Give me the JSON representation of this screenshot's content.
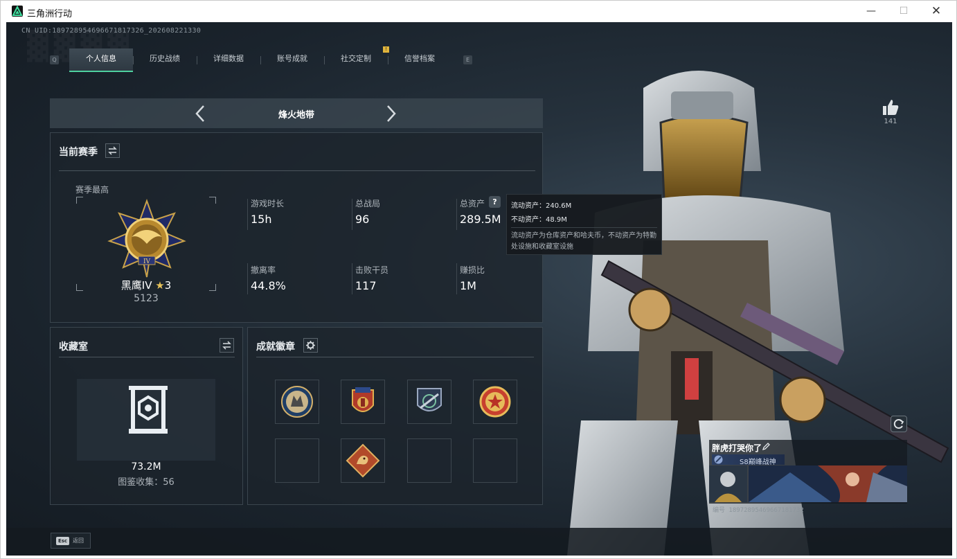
{
  "window": {
    "title": "三角洲行动",
    "minimize_label": "—",
    "maximize_label": "☐",
    "close_label": "✕"
  },
  "header": {
    "uid": "CN UID:18972895469667181732​6_202608221330",
    "tab_key_left": "Q",
    "tab_key_right": "E",
    "tabs": [
      {
        "label": "个人信息",
        "active": true
      },
      {
        "label": "历史战绩",
        "active": false
      },
      {
        "label": "详细数据",
        "active": false
      },
      {
        "label": "账号成就",
        "active": false
      },
      {
        "label": "社交定制",
        "active": false,
        "badge": "!"
      },
      {
        "label": "信誉档案",
        "active": false
      }
    ]
  },
  "mode": {
    "title": "烽火地带",
    "prev_icon": "chevron-left-icon",
    "next_icon": "chevron-right-icon"
  },
  "season": {
    "title": "当前赛季",
    "season_best_label": "赛季最高",
    "rank_name": "黑鹰IV",
    "rank_star": "★",
    "rank_stars": "3",
    "rank_score": "5123",
    "stats": [
      {
        "label": "游戏时长",
        "value": "15h"
      },
      {
        "label": "总战局",
        "value": "96"
      },
      {
        "label": "总资产",
        "value": "289.5M"
      },
      {
        "label": "撤离率",
        "value": "44.8%"
      },
      {
        "label": "击败干员",
        "value": "117"
      },
      {
        "label": "赚损比",
        "value": "1M"
      }
    ],
    "help_label": "?"
  },
  "tooltip": {
    "liquid": "流动资产：240.6M",
    "fixed": "不动资产：48.9M",
    "description": "流动资产为仓库资产和哈夫币，不动资产为特勤处设施和收藏室设施"
  },
  "collection": {
    "title": "收藏室",
    "value": "73.2M",
    "sub_label": "图鉴收集：56"
  },
  "achievements": {
    "title": "成就徽章",
    "badges": [
      "wolf-badge",
      "eagle-shield-badge",
      "rifle-badge",
      "star-badge",
      "empty",
      "dragon-badge",
      "empty",
      "empty"
    ]
  },
  "footer": {
    "esc_key": "Esc",
    "esc_label": "返回"
  },
  "profile": {
    "like_count": "141",
    "player_name": "胖虎打哭你了",
    "title_text": "S8巅峰战神",
    "player_id": "编号 1897289546966718173​2"
  },
  "colors": {
    "accent": "#4fd1a0",
    "gold": "#e6c25a",
    "panel": "#1c242c"
  }
}
